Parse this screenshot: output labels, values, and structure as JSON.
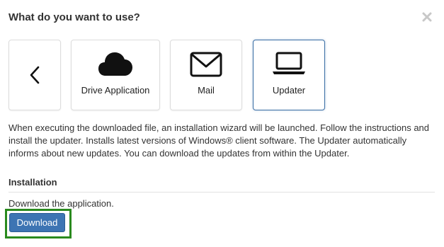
{
  "dialog": {
    "title": "What do you want to use?",
    "close_icon": "close-icon"
  },
  "tiles": [
    {
      "id": "back",
      "label": "",
      "icon": "chevron-left-icon",
      "selected": false
    },
    {
      "id": "drive",
      "label": "Drive Application",
      "icon": "cloud-icon",
      "selected": false
    },
    {
      "id": "mail",
      "label": "Mail",
      "icon": "envelope-icon",
      "selected": false
    },
    {
      "id": "updater",
      "label": "Updater",
      "icon": "laptop-icon",
      "selected": true
    }
  ],
  "description": "When executing the downloaded file, an installation wizard will be launched. Follow the instructions and install the updater. Installs latest versions of Windows® client software. The Updater automatically informs about new updates. You can download the updates from within the Updater.",
  "installation": {
    "title": "Installation",
    "text": "Download the application.",
    "download_label": "Download"
  },
  "colors": {
    "accent": "#3d74b3",
    "selected_border": "#3a6ea5",
    "highlight": "#2a8a1e"
  }
}
